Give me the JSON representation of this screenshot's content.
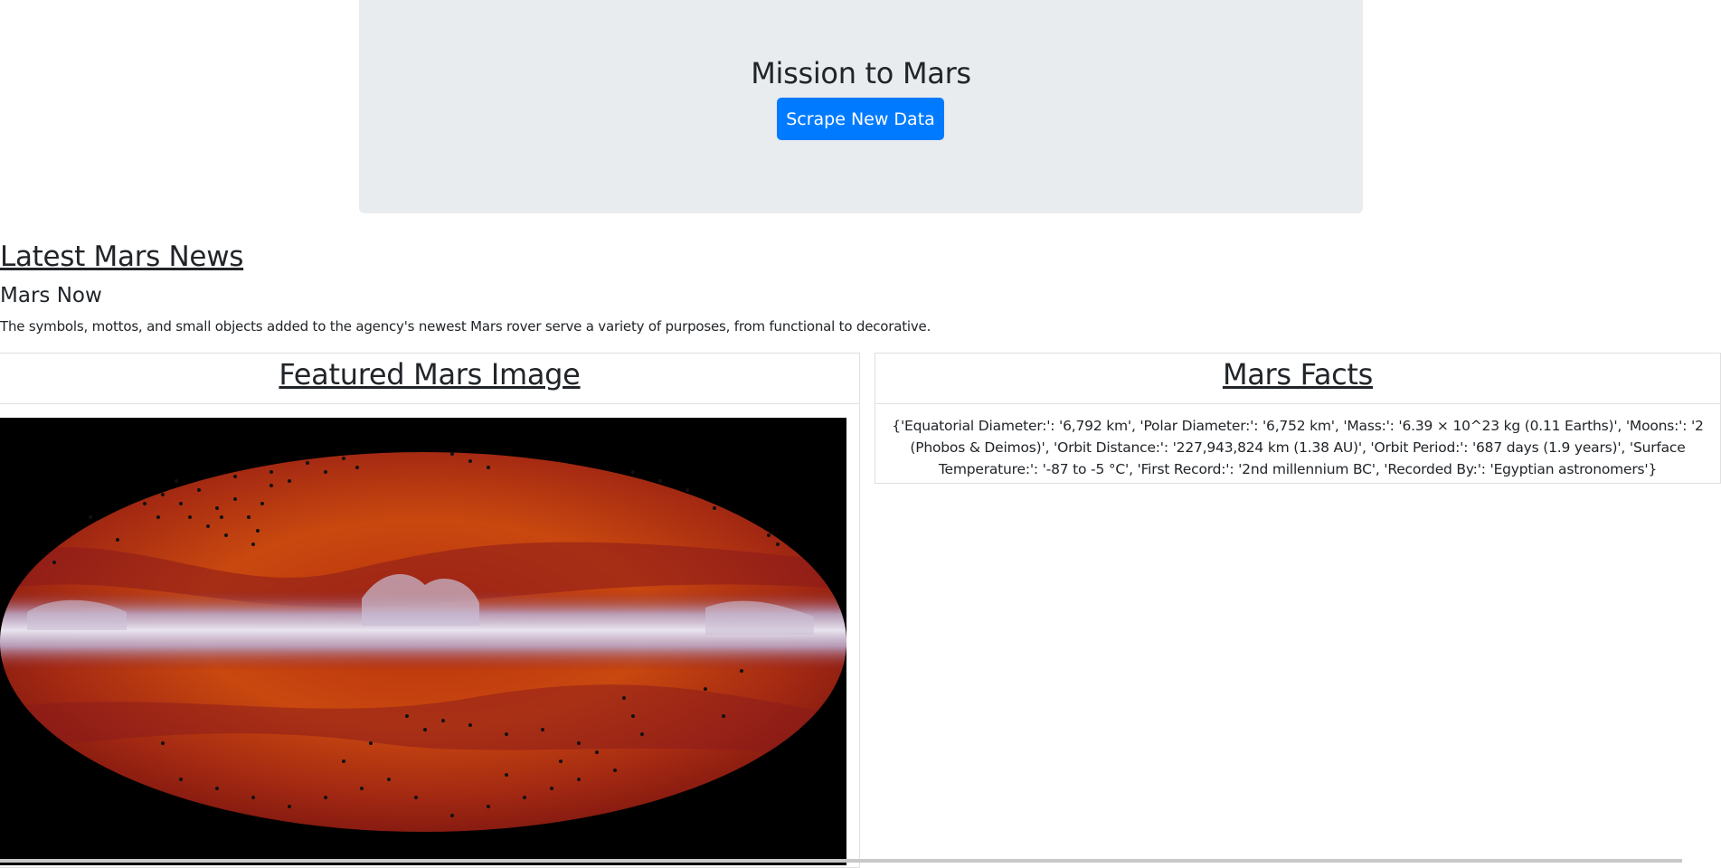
{
  "header": {
    "title": "Mission to Mars",
    "scrape_button_label": "Scrape New Data"
  },
  "news": {
    "section_title": "Latest Mars News",
    "headline": "Mars Now",
    "teaser": "The symbols, mottos, and small objects added to the agency's newest Mars rover serve a variety of purposes, from functional to decorative."
  },
  "featured_image": {
    "title": "Featured Mars Image"
  },
  "facts": {
    "title": "Mars Facts",
    "text": "{'Equatorial Diameter:': '6,792 km', 'Polar Diameter:': '6,752 km', 'Mass:': '6.39 × 10^23 kg (0.11 Earths)', 'Moons:': '2 (Phobos & Deimos)', 'Orbit Distance:': '227,943,824 km (1.38 AU)', 'Orbit Period:': '687 days (1.9 years)', 'Surface Temperature:': '-87 to -5 °C', 'First Record:': '2nd millennium BC', 'Recorded By:': 'Egyptian astronomers'}"
  },
  "colors": {
    "jumbotron_bg": "#e9ecef",
    "primary_button": "#007bff",
    "card_border": "#dfdfdf"
  }
}
